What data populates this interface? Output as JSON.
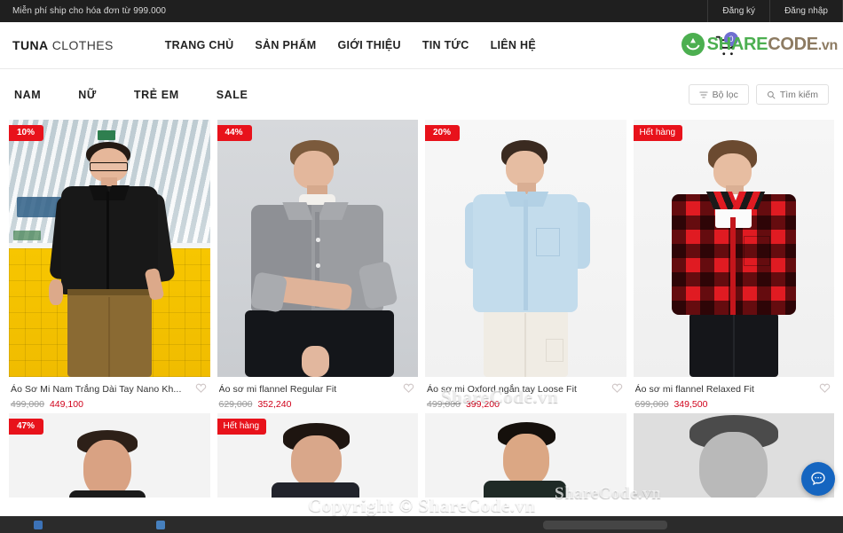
{
  "topbar": {
    "promo": "Miễn phí ship cho hóa đơn từ 999.000",
    "register": "Đăng ký",
    "login": "Đăng nhập"
  },
  "header": {
    "brand_bold": "TUNA",
    "brand_light": "CLOTHES",
    "nav": [
      {
        "label": "TRANG CHỦ"
      },
      {
        "label": "SẢN PHẨM"
      },
      {
        "label": "GIỚI THIỆU"
      },
      {
        "label": "TIN TỨC"
      },
      {
        "label": "LIÊN HỆ"
      }
    ],
    "cart_count": "0",
    "cart_icon": "shopping-cart-icon"
  },
  "watermark": {
    "logo_part1": "SHARE",
    "logo_part2": "CODE",
    "logo_part3": ".vn",
    "overlay_a": "ShareCode.vn",
    "overlay_b": "Copyright © ShareCode.vn",
    "overlay_c": "ShareCode.vn"
  },
  "categories": [
    {
      "label": "NAM"
    },
    {
      "label": "NỮ"
    },
    {
      "label": "TRẺ EM"
    },
    {
      "label": "SALE"
    }
  ],
  "tools": {
    "filter_label": "Bộ lọc",
    "filter_icon": "filter-icon",
    "search_label": "Tìm kiếm",
    "search_icon": "search-icon"
  },
  "colors": {
    "badge_red": "#e8121b",
    "price_red": "#d0021b",
    "chat_blue": "#1565c0",
    "cart_badge": "#6f6fd0",
    "topbar_bg": "#1f1f1f"
  },
  "products_row1": [
    {
      "badge": "10%",
      "badge_type": "discount",
      "name": "Áo Sơ Mi Nam Trắng Dài Tay Nano Kh...",
      "old_price": "499,000",
      "new_price": "449,100",
      "wishlist_icon": "heart-icon"
    },
    {
      "badge": "44%",
      "badge_type": "discount",
      "name": "Áo sơ mi flannel Regular Fit",
      "old_price": "629,000",
      "new_price": "352,240",
      "wishlist_icon": "heart-icon"
    },
    {
      "badge": "20%",
      "badge_type": "discount",
      "name": "Áo sơ mi Oxford ngắn tay Loose Fit",
      "old_price": "499,000",
      "new_price": "399,200",
      "wishlist_icon": "heart-icon"
    },
    {
      "badge": "Hết hàng",
      "badge_type": "out-of-stock",
      "name": "Áo sơ mi flannel Relaxed Fit",
      "old_price": "699,000",
      "new_price": "349,500",
      "wishlist_icon": "heart-icon"
    }
  ],
  "products_row2": [
    {
      "badge": "47%",
      "badge_type": "discount"
    },
    {
      "badge": "Hết hàng",
      "badge_type": "out-of-stock"
    },
    {
      "badge": "",
      "badge_type": "none"
    },
    {
      "badge": "",
      "badge_type": "none"
    }
  ],
  "chat": {
    "icon": "chat-bubble-icon"
  }
}
